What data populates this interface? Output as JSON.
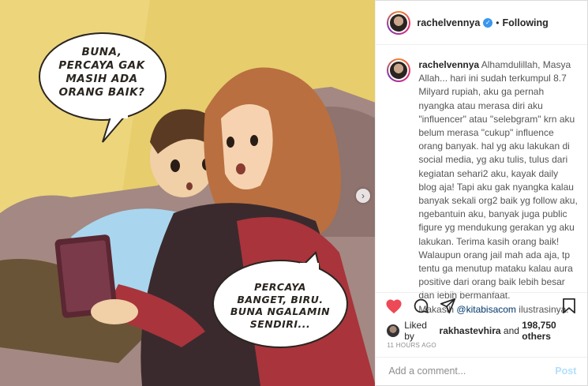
{
  "post": {
    "username": "rachelvennya",
    "separator": "•",
    "follow_status": "Following"
  },
  "media": {
    "bubble_1": "BUNA,\nPERCAYA GAK\nMASIH ADA\nORANG BAIK?",
    "bubble_2": "PERCAYA\nBANGET, BIRU.\nBUNA NGALAMIN\nSENDIRI...",
    "carousel_next": "›"
  },
  "caption": {
    "username": "rachelvennya",
    "text_1": " Alhamdulillah, Masya Allah... hari ini sudah terkumpul 8.7 Milyard rupiah, aku ga pernah nyangka atau merasa diri aku \"influencer\" atau \"selebgram\" krn aku belum merasa \"cukup\" influence orang banyak. hal yg aku lakukan di social media, yg aku tulis, tulus dari kegiatan sehari2 aku, kayak daily blog aja! Tapi aku gak nyangka kalau banyak sekali org2 baik yg follow aku, ngebantuin aku, banyak juga public figure yg mendukung gerakan yg aku lakukan. Terima kasih orang baik! Walaupun orang jail mah ada aja, tp tentu ga menutup mataku kalau aura positive dari orang baik lebih besar dan lebih bermanfaat.",
    "text_2": "Makasih ",
    "mention": "@kitabisacom",
    "text_3": " ilustrasinya."
  },
  "likes": {
    "prefix": "Liked by ",
    "user": "rakhastevhira",
    "middle": " and ",
    "count": "198,750 others"
  },
  "timestamp": "11 HOURS AGO",
  "comment": {
    "placeholder": "Add a comment...",
    "post_label": "Post"
  },
  "icons": {
    "like": "heart-icon",
    "comment": "comment-icon",
    "share": "share-icon",
    "save": "bookmark-icon"
  },
  "colors": {
    "like_red": "#ed4956",
    "verified_blue": "#3897f0",
    "post_disabled": "#b2dffc"
  }
}
